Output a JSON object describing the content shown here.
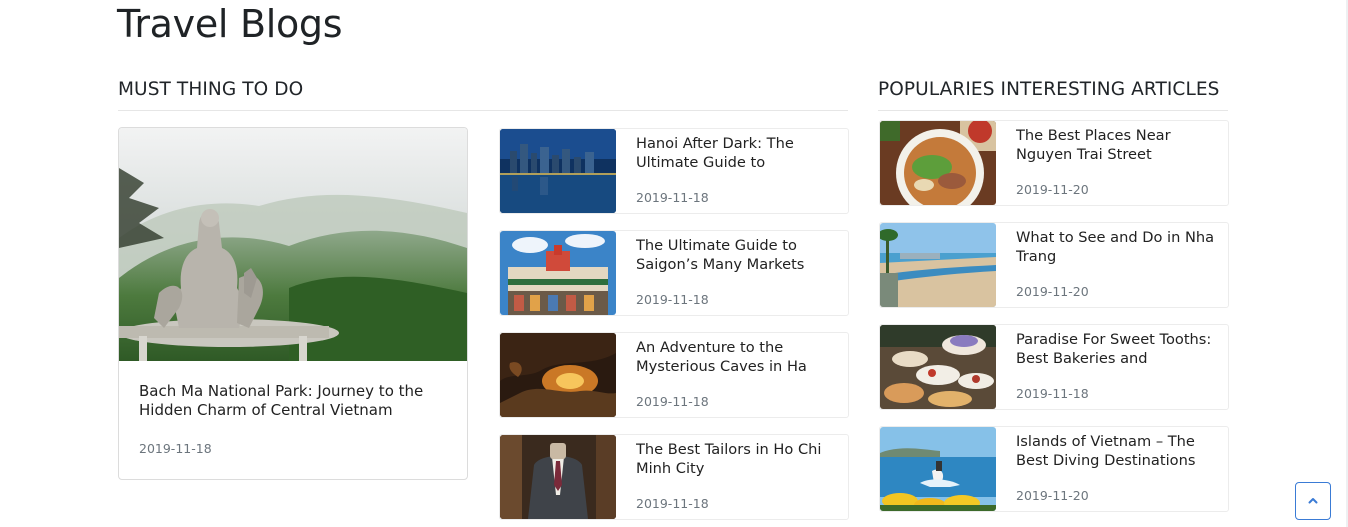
{
  "page": {
    "title": "Travel Blogs"
  },
  "must_do": {
    "heading": "MUST THING TO DO",
    "featured": {
      "title": "Bach Ma National Park: Journey to the Hidden Charm of Central Vietnam",
      "date": "2019-11-18",
      "image": "misty-forest-buddha-statue"
    },
    "items": [
      {
        "title": "Hanoi After Dark: The Ultimate Guide to",
        "date": "2019-11-18",
        "image": "city-night-skyline"
      },
      {
        "title": "The Ultimate Guide to Saigon’s Many Markets",
        "date": "2019-11-18",
        "image": "market-building"
      },
      {
        "title": "An Adventure to the Mysterious Caves in Ha",
        "date": "2019-11-18",
        "image": "lit-cave"
      },
      {
        "title": "The Best Tailors in Ho Chi Minh City",
        "date": "2019-11-18",
        "image": "suit-mannequin"
      }
    ]
  },
  "popular": {
    "heading": "POPULARIES INTERESTING ARTICLES",
    "items": [
      {
        "title": "The Best Places Near Nguyen Trai Street",
        "date": "2019-11-20",
        "image": "pho-bowl"
      },
      {
        "title": "What to See and Do in Nha Trang",
        "date": "2019-11-20",
        "image": "beach-coast"
      },
      {
        "title": "Paradise For Sweet Tooths: Best Bakeries and",
        "date": "2019-11-18",
        "image": "pastry-table"
      },
      {
        "title": "Islands of Vietnam – The Best Diving Destinations",
        "date": "2019-11-20",
        "image": "flyboard-sea"
      }
    ]
  },
  "ui": {
    "back_to_top_icon": "chevron-up-icon",
    "accent": "#3a7bd5"
  }
}
